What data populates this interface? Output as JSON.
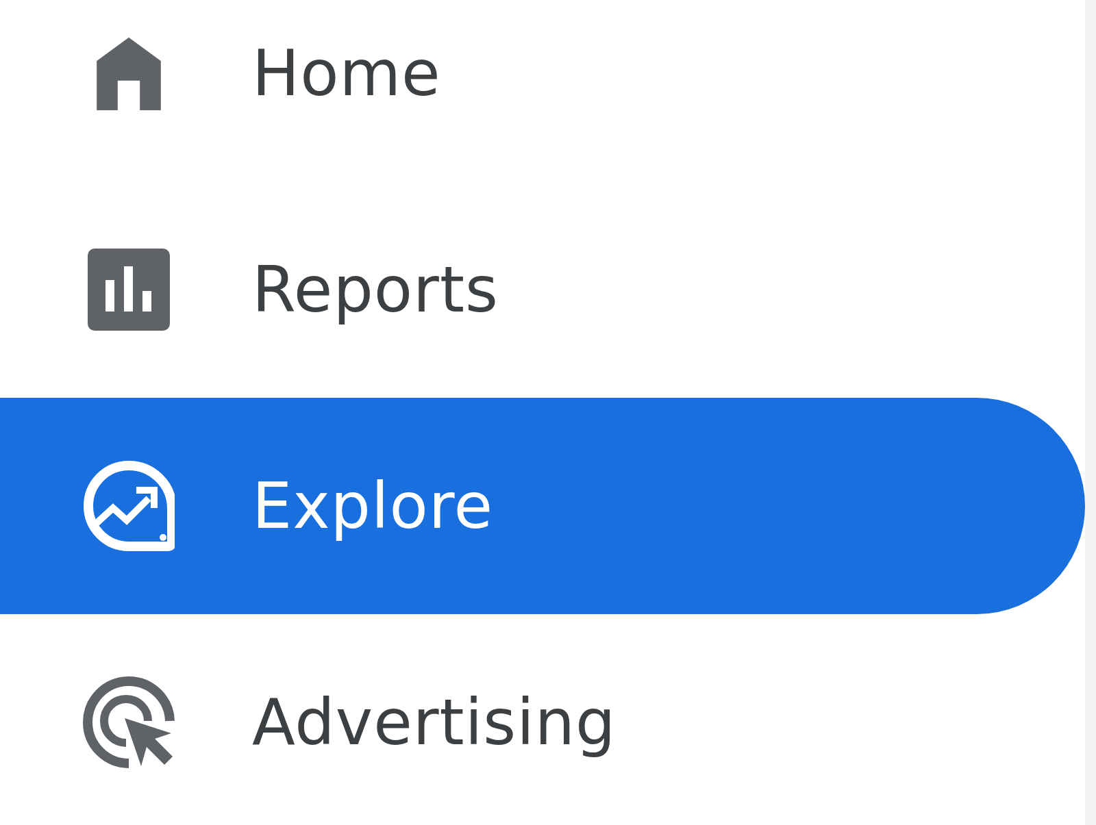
{
  "sidebar": {
    "items": [
      {
        "label": "Home",
        "selected": false
      },
      {
        "label": "Reports",
        "selected": false
      },
      {
        "label": "Explore",
        "selected": true
      },
      {
        "label": "Advertising",
        "selected": false
      }
    ]
  }
}
